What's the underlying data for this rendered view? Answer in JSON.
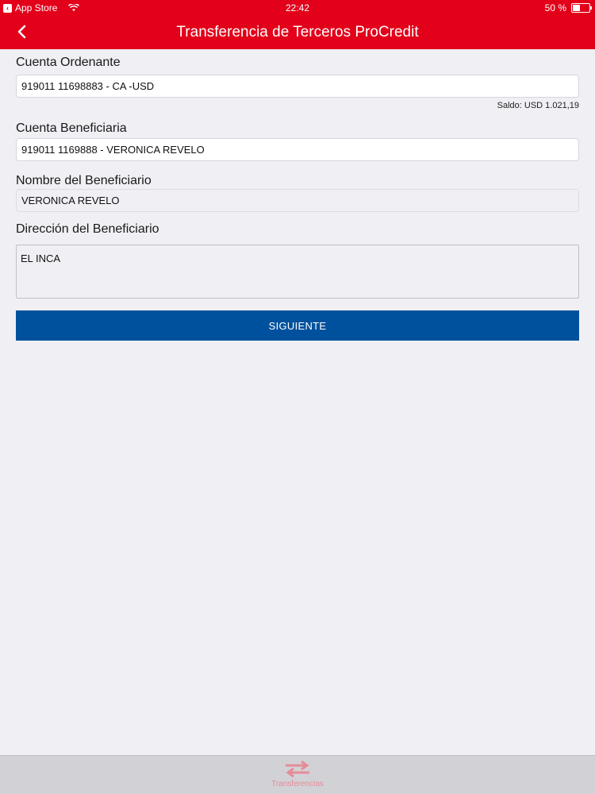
{
  "status_bar": {
    "back_app": "App Store",
    "time": "22:42",
    "battery_text": "50 %",
    "battery_level": 0.5
  },
  "nav": {
    "title": "Transferencia de Terceros ProCredit"
  },
  "form": {
    "ordering_account_label": "Cuenta Ordenante",
    "ordering_account_value": "919011 11698883 - CA -USD",
    "balance_text": "Saldo: USD 1.021,19",
    "beneficiary_account_label": "Cuenta Beneficiaria",
    "beneficiary_account_value": "919011 1169888 - VERONICA REVELO",
    "beneficiary_name_label": "Nombre del Beneficiario",
    "beneficiary_name_value": "VERONICA REVELO",
    "beneficiary_address_label": "Dirección del Beneficiario",
    "beneficiary_address_value": "EL INCA",
    "next_button": "SIGUIENTE"
  },
  "tabbar": {
    "tabs": [
      {
        "label": "Transferencias",
        "icon": "transfer-arrows-icon",
        "active": true
      }
    ]
  },
  "colors": {
    "brand_red": "#e2001a",
    "button_blue": "#00519d",
    "background": "#efeff4"
  }
}
